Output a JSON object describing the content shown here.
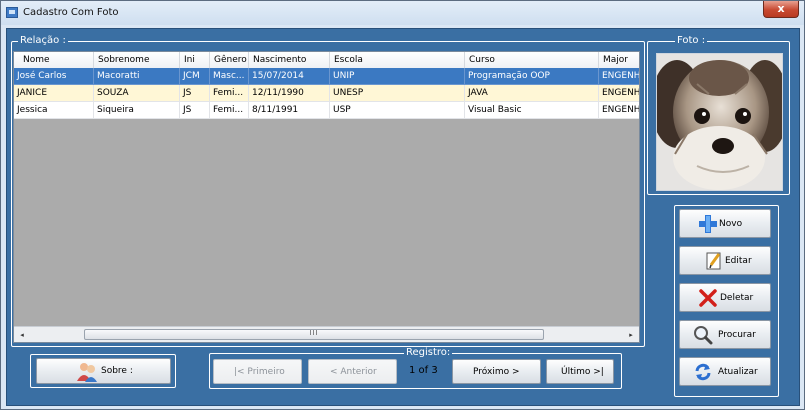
{
  "window": {
    "title": "Cadastro Com Foto",
    "close_glyph": "x"
  },
  "relacao": {
    "legend": "Relação :",
    "columns": [
      "Nome",
      "Sobrenome",
      "Ini",
      "Gênero",
      "Nascimento",
      "Escola",
      "Curso",
      "Major"
    ],
    "rows": [
      [
        "José Carlos",
        "Macoratti",
        "JCM",
        "Masc...",
        "15/07/2014",
        "UNIP",
        "Programação OOP",
        "ENGENHA"
      ],
      [
        "JANICE",
        "SOUZA",
        "JS",
        "Femi...",
        "12/11/1990",
        "UNESP",
        "JAVA",
        "ENGENHA"
      ],
      [
        "Jessica",
        "Siqueira",
        "JS",
        "Femi...",
        "8/11/1991",
        "USP",
        "Visual Basic",
        "ENGENHA"
      ]
    ],
    "selected_row": 0,
    "scroll": {
      "left_glyph": "◂",
      "right_glyph": "▸",
      "grip": "III"
    }
  },
  "foto": {
    "legend": "Foto :"
  },
  "actions": {
    "novo": "Novo",
    "editar": "Editar",
    "deletar": "Deletar",
    "procurar": "Procurar",
    "atualizar": "Atualizar"
  },
  "sobre": {
    "label": "Sobre :"
  },
  "registro": {
    "legend": "Registro:",
    "primeiro": "|< Primeiro",
    "anterior": "< Anterior",
    "count": "1 of 3",
    "proximo": "Próximo >",
    "ultimo": "Último >|"
  },
  "colors": {
    "accent": "#3a6fa3",
    "selected_row": "#3b79c2",
    "alt_row": "#fff7d6",
    "grid_empty": "#ababab"
  }
}
